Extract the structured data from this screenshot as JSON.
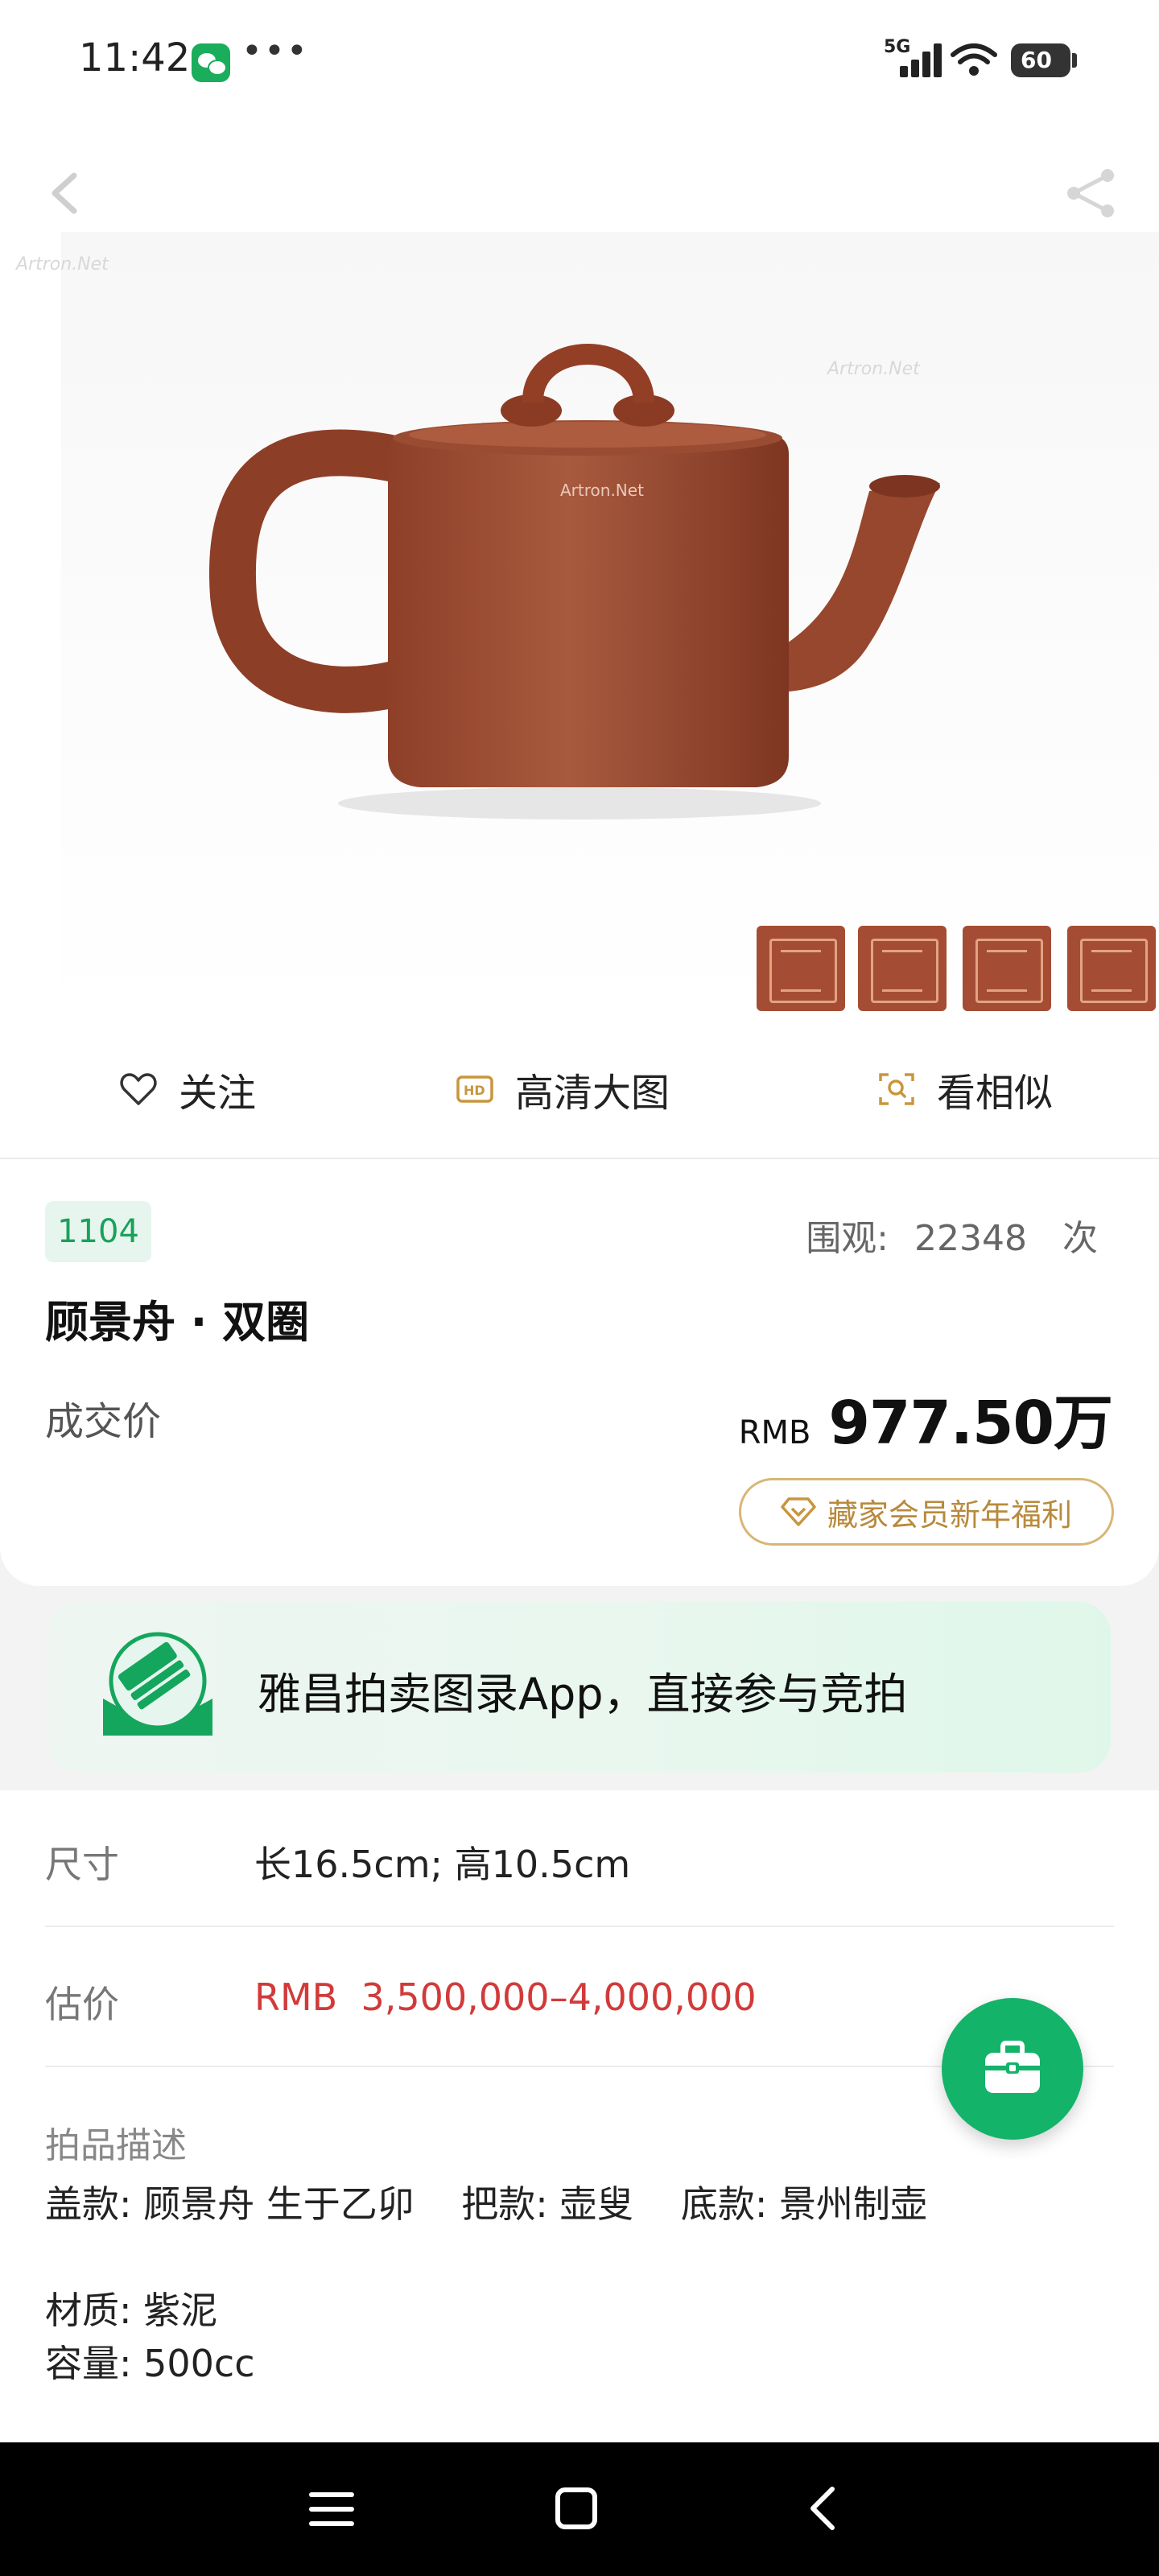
{
  "status_bar": {
    "time": "11:42",
    "dots": "•••",
    "network": "5G",
    "battery": "60"
  },
  "hero": {
    "watermark": "Artron.Net",
    "image_alt": "紫泥双圈壶"
  },
  "actions": {
    "follow": "关注",
    "hd_image": "高清大图",
    "similar": "看相似"
  },
  "lot": {
    "number": "1104",
    "views_label": "围观:",
    "views_count": "22348",
    "views_unit": "次",
    "title": "顾景舟 · 双圈",
    "deal_label": "成交价",
    "price_currency": "RMB",
    "price_value": "977.50万",
    "member_benefit": "藏家会员新年福利"
  },
  "promo": {
    "text": "雅昌拍卖图录App，直接参与竞拍"
  },
  "details": {
    "size_label": "尺寸",
    "size_value": "长16.5cm; 高10.5cm",
    "estimate_label": "估价",
    "estimate_value": "RMB  3,500,000–4,000,000",
    "desc_title": "拍品描述",
    "desc_line1": "盖款: 顾景舟 生于乙卯    把款: 壶叟    底款: 景州制壶",
    "desc_line2": "材质: 紫泥",
    "desc_line3": "容量: 500cc"
  },
  "colors": {
    "accent_green": "#14b36a",
    "price_red": "#d23a3a",
    "gold": "#b88a3d",
    "clay": "#a54d34"
  }
}
